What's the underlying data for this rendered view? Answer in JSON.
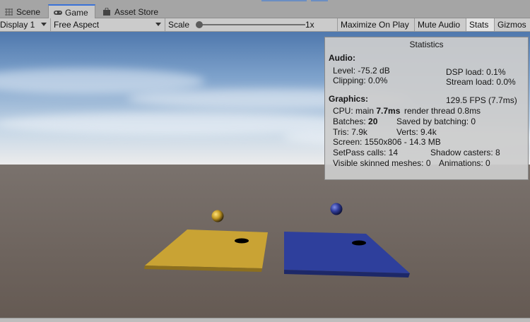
{
  "tabs": [
    {
      "label": "Scene",
      "icon": "scene-grid-icon",
      "active": false
    },
    {
      "label": "Game",
      "icon": "gamepad-icon",
      "active": true
    },
    {
      "label": "Asset Store",
      "icon": "store-bag-icon",
      "active": false
    }
  ],
  "toolbar": {
    "display": "Display 1",
    "aspect": "Free Aspect",
    "scale_label": "Scale",
    "scale_value": "1x",
    "maximize": "Maximize On Play",
    "mute": "Mute Audio",
    "stats": "Stats",
    "gizmos": "Gizmos"
  },
  "stats": {
    "title": "Statistics",
    "audio": {
      "heading": "Audio:",
      "level": "Level: -75.2 dB",
      "clipping": "Clipping: 0.0%",
      "dsp": "DSP load: 0.1%",
      "stream": "Stream load: 0.0%"
    },
    "graphics": {
      "heading": "Graphics:",
      "fps": "129.5 FPS (7.7ms)",
      "cpu_prefix": "CPU: main ",
      "cpu_main": "7.7ms",
      "render_thread": "render thread 0.8ms",
      "batches_prefix": "Batches: ",
      "batches": "20",
      "saved_batching": "Saved by batching: 0",
      "tris": "Tris: 7.9k",
      "verts": "Verts: 9.4k",
      "screen": "Screen: 1550x806 - 14.3 MB",
      "setpass": "SetPass calls: 14",
      "shadow_casters": "Shadow casters: 8",
      "skinned": "Visible skinned meshes: 0",
      "animations": "Animations: 0"
    }
  },
  "colors": {
    "accent": "#3a72d8",
    "yellow_plane": "#c9a334",
    "blue_plane": "#2e3f9c",
    "ground": "#6a5f58"
  }
}
